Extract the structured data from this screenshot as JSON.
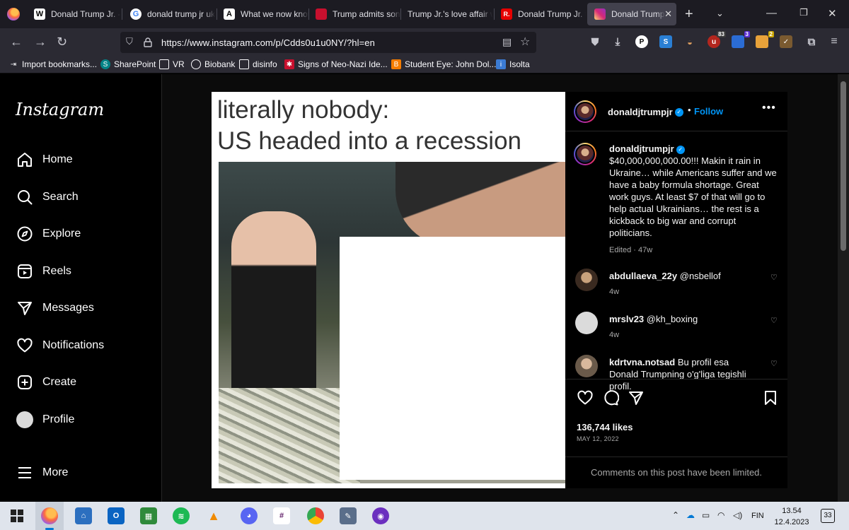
{
  "browser": {
    "tabs": [
      {
        "title": "Donald Trump Jr. -",
        "favicon": "wikipedia-icon",
        "favicon_text": "W",
        "favicon_color": "#ffffff"
      },
      {
        "title": "donald trump jr uk",
        "favicon": "google-icon",
        "favicon_text": "G",
        "favicon_color": "#ffffff"
      },
      {
        "title": "What we now know",
        "favicon": "atlantic-icon",
        "favicon_text": "A",
        "favicon_color": "#ffffff"
      },
      {
        "title": "Trump admits son",
        "favicon": "news-icon",
        "favicon_text": "",
        "favicon_color": "#c8102e"
      },
      {
        "title": "Trump Jr.'s love affair w",
        "favicon": "",
        "favicon_text": "",
        "favicon_color": ""
      },
      {
        "title": "Donald Trump Jr. t",
        "favicon": "reuters-icon",
        "favicon_text": "R.",
        "favicon_color": "#e60000"
      },
      {
        "title": "Donald Trump Jr.",
        "favicon": "instagram-icon",
        "favicon_text": "",
        "favicon_color": "#d62976",
        "active": true
      }
    ],
    "url": "https://www.instagram.com/p/Cdds0u1u0NY/?hl=en",
    "extension_badges": {
      "ext1": "83",
      "ext2": "3",
      "ext3": "2"
    },
    "bookmarks": [
      {
        "label": "Import bookmarks...",
        "icon": "import-icon"
      },
      {
        "label": "SharePoint",
        "icon": "sharepoint-icon"
      },
      {
        "label": "VR",
        "icon": "folder-icon"
      },
      {
        "label": "Biobank",
        "icon": "globe-icon"
      },
      {
        "label": "disinfo",
        "icon": "folder-icon"
      },
      {
        "label": "Signs of Neo-Nazi Ide...",
        "icon": "site-icon"
      },
      {
        "label": "Student Eye: John Dol...",
        "icon": "blogger-icon"
      },
      {
        "label": "Isolta",
        "icon": "isolta-icon"
      }
    ]
  },
  "instagram": {
    "logo": "Instagram",
    "nav": [
      {
        "label": "Home",
        "icon": "home-icon"
      },
      {
        "label": "Search",
        "icon": "search-icon"
      },
      {
        "label": "Explore",
        "icon": "compass-icon"
      },
      {
        "label": "Reels",
        "icon": "reels-icon"
      },
      {
        "label": "Messages",
        "icon": "paper-plane-icon"
      },
      {
        "label": "Notifications",
        "icon": "heart-icon"
      },
      {
        "label": "Create",
        "icon": "plus-square-icon"
      },
      {
        "label": "Profile",
        "icon": "avatar-icon"
      },
      {
        "label": "More",
        "icon": "hamburger-icon"
      }
    ],
    "post": {
      "image_text": [
        "literally nobody:",
        "US headed into a recession"
      ],
      "author": "donaldjtrumpjr",
      "header_dot": "•",
      "follow_label": "Follow",
      "more_label": "•••",
      "caption": "$40,000,000,000.00!!! Makin it rain in Ukraine… while Americans suffer and we have a baby formula shortage. Great work guys. At least $7 of that will go to help actual Ukrainians… the rest is a kickback to big war and corrupt politicians.",
      "caption_meta": "Edited · 47w",
      "comments": [
        {
          "user": "abdullaeva_22y",
          "text": "@nsbellof",
          "time": "4w"
        },
        {
          "user": "mrslv23",
          "text": "@kh_boxing",
          "time": "4w"
        },
        {
          "user": "kdrtvna.notsad",
          "text": "Bu profil esa Donald Trumpning o'g'liga tegishli profil.",
          "time": ""
        }
      ],
      "likes": "136,744 likes",
      "date": "MAY 12, 2022",
      "comments_limited": "Comments on this post have been limited."
    }
  },
  "taskbar": {
    "language": "FIN",
    "time": "13.54",
    "date": "12.4.2023",
    "notifications": "33"
  },
  "colors": {
    "accent_blue": "#0095f6",
    "browser_bg": "#1c1b22",
    "toolbar_bg": "#2b2a33",
    "taskbar_bg": "#dfe4ec"
  }
}
